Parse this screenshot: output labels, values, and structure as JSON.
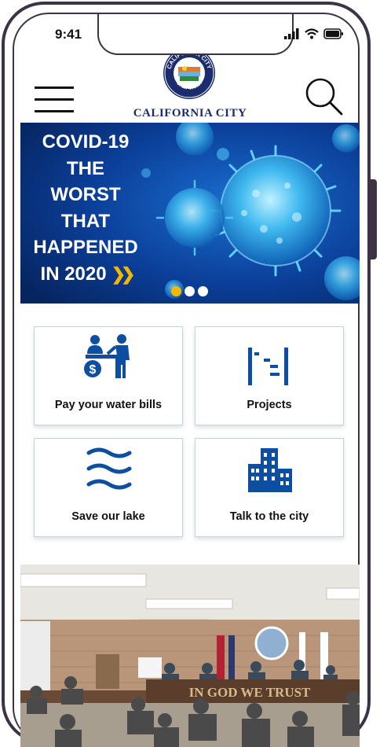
{
  "status_bar": {
    "time": "9:41"
  },
  "header": {
    "logo_ring_text": "CALIFORNIA CITY",
    "logo_bottom_text": "CALIFORNIA",
    "city_name": "CALIFORNIA CITY"
  },
  "banner": {
    "lines": [
      "COVID-19",
      "THE",
      "WORST",
      "THAT",
      "HAPPENED",
      "IN 2020"
    ],
    "active_slide": 1,
    "slide_count": 3
  },
  "tiles": [
    {
      "label": "Pay your water bills",
      "icon": "cashier-payment-icon"
    },
    {
      "label": "Projects",
      "icon": "projects-icon"
    },
    {
      "label": "Save our lake",
      "icon": "water-waves-icon"
    },
    {
      "label": "Talk to the city",
      "icon": "city-building-icon"
    }
  ],
  "council_photo": {
    "dais_sign": "IN GOD WE TRUST"
  },
  "colors": {
    "brand_blue": "#0b4ea2",
    "title_navy": "#1a2b6e",
    "accent_yellow": "#f4b800",
    "frame": "#3d3345"
  }
}
